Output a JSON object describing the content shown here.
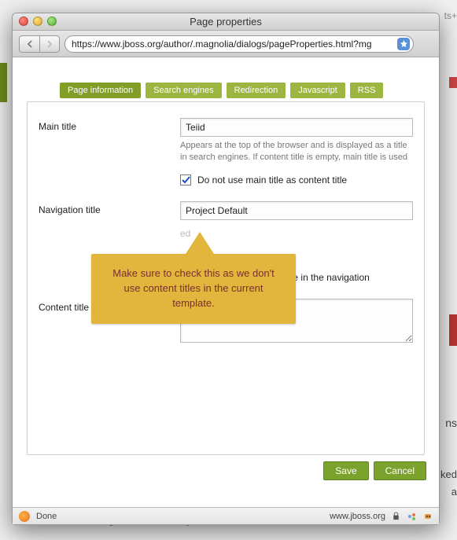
{
  "window": {
    "title": "Page properties"
  },
  "url": "https://www.jboss.org/author/.magnolia/dialogs/pageProperties.html?mg",
  "tabs": [
    {
      "label": "Page information",
      "active": true
    },
    {
      "label": "Search engines"
    },
    {
      "label": "Redirection"
    },
    {
      "label": "Javascript"
    },
    {
      "label": "RSS"
    }
  ],
  "form": {
    "main_title_label": "Main title",
    "main_title_value": "Teiid",
    "main_title_help": "Appears at the top of the browser and is displayed as a title in search engines. If content title is empty, main title is used",
    "main_title_checkbox_label": "Do not use main title as content title",
    "main_title_checkbox_checked": true,
    "nav_title_label": "Navigation title",
    "nav_title_value": "Project Default",
    "nav_hidden_text": "ed",
    "nav_checkbox_label": "Do not display this page in the navigation",
    "nav_checkbox_checked": false,
    "content_title_label": "Content title",
    "content_title_value": ""
  },
  "callout": "Make sure to check this as we don't use content titles in the current template.",
  "buttons": {
    "save": "Save",
    "cancel": "Cancel"
  },
  "status": {
    "left": "Done",
    "right": "www.jboss.org"
  },
  "bg": {
    "bottom_text": "moving data from its system of record.",
    "r1": "ns",
    "r2": "ked",
    "r3": "a",
    "top": "ts+"
  }
}
